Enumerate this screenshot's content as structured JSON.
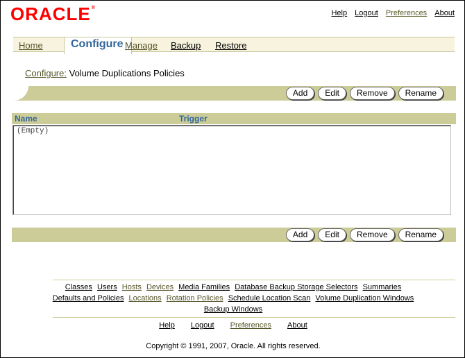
{
  "brand": {
    "logo_text": "ORACLE",
    "logo_mark": "®",
    "color": "#ff0000"
  },
  "global_links": [
    "Help",
    "Logout",
    "Preferences",
    "About"
  ],
  "tabs": [
    {
      "label": "Home",
      "active": false
    },
    {
      "label": "Configure",
      "active": true
    },
    {
      "label": "Manage",
      "active": false
    },
    {
      "label": "Backup",
      "active": false
    },
    {
      "label": "Restore",
      "active": false
    }
  ],
  "breadcrumb": {
    "parent": "Configure:",
    "current": "Volume Duplications Policies"
  },
  "actions": {
    "add": "Add",
    "edit": "Edit",
    "remove": "Remove",
    "rename": "Rename"
  },
  "table": {
    "columns": [
      "Name",
      "Trigger"
    ],
    "empty_text": "(Empty)"
  },
  "footer": {
    "row1": [
      "Classes",
      "Users",
      "Hosts",
      "Devices",
      "Media Families",
      "Database Backup Storage Selectors",
      "Summaries"
    ],
    "row2": [
      "Defaults and Policies",
      "Locations",
      "Rotation Policies",
      "Schedule Location Scan",
      "Volume Duplication Windows"
    ],
    "row3": [
      "Backup Windows"
    ],
    "row4": [
      "Help",
      "Logout",
      "Preferences",
      "About"
    ],
    "copyright": "Copyright © 1991, 2007, Oracle. All rights reserved."
  },
  "colors": {
    "accent": "#336699",
    "bar": "#cccc99",
    "tab_bg": "#f7f3df"
  }
}
